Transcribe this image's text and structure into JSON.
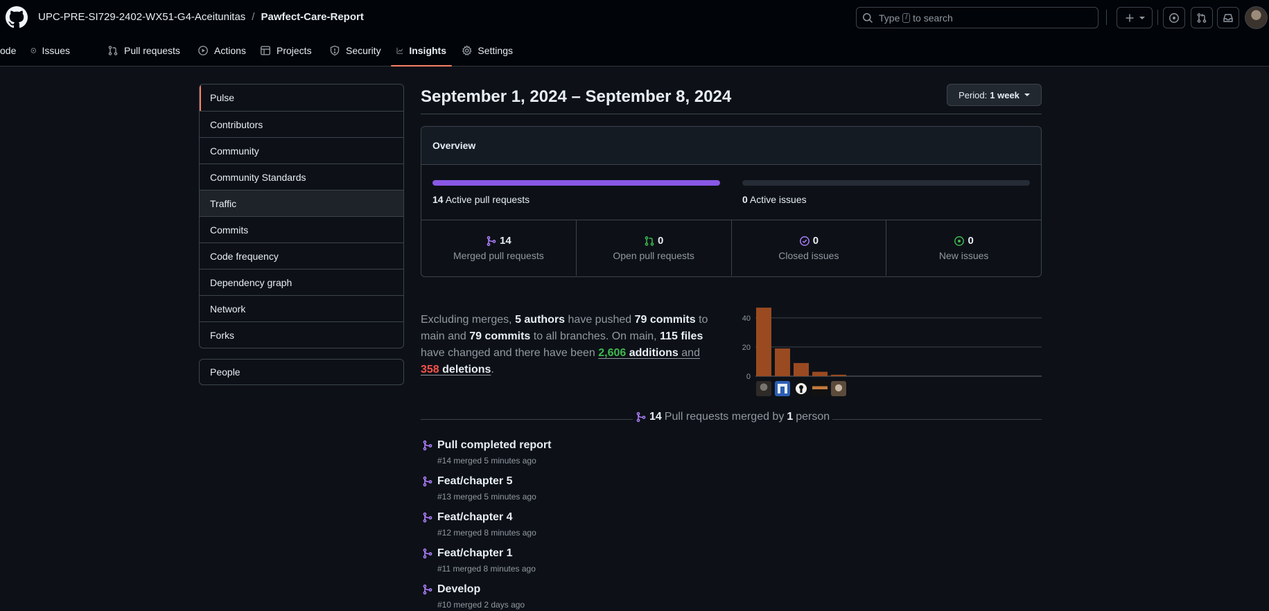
{
  "header": {
    "owner": "UPC-PRE-SI729-2402-WX51-G4-Aceitunitas",
    "separator": "/",
    "repo": "Pawfect-Care-Report",
    "search_prefix": "Type",
    "search_key": "/",
    "search_suffix": "to search"
  },
  "tabs": [
    {
      "label": "ode",
      "icon": "code-icon"
    },
    {
      "label": "Issues",
      "icon": "issue-opened-icon"
    },
    {
      "label": "Pull requests",
      "icon": "git-pull-request-icon"
    },
    {
      "label": "Actions",
      "icon": "play-icon"
    },
    {
      "label": "Projects",
      "icon": "table-icon"
    },
    {
      "label": "Security",
      "icon": "shield-icon"
    },
    {
      "label": "Insights",
      "icon": "graph-icon",
      "active": true
    },
    {
      "label": "Settings",
      "icon": "gear-icon"
    }
  ],
  "sidebar": {
    "items": [
      {
        "label": "Pulse",
        "selected": true
      },
      {
        "label": "Contributors"
      },
      {
        "label": "Community"
      },
      {
        "label": "Community Standards"
      },
      {
        "label": "Traffic",
        "hover": true
      },
      {
        "label": "Commits"
      },
      {
        "label": "Code frequency"
      },
      {
        "label": "Dependency graph"
      },
      {
        "label": "Network"
      },
      {
        "label": "Forks"
      }
    ],
    "people": "People"
  },
  "main": {
    "date_range": "September 1, 2024 – September 8, 2024",
    "period_prefix": "Period:",
    "period_value": "1 week"
  },
  "overview": {
    "title": "Overview",
    "active_prs_count": "14",
    "active_prs_label": "Active pull requests",
    "active_prs_fraction": 1.0,
    "active_issues_count": "0",
    "active_issues_label": "Active issues",
    "active_issues_fraction": 0.0,
    "stats": [
      {
        "value": "14",
        "label": "Merged pull requests",
        "icon": "git-merge-icon",
        "color": "#ab7df8"
      },
      {
        "value": "0",
        "label": "Open pull requests",
        "icon": "git-pull-request-icon",
        "color": "#3fb950"
      },
      {
        "value": "0",
        "label": "Closed issues",
        "icon": "issue-closed-icon",
        "color": "#ab7df8"
      },
      {
        "value": "0",
        "label": "New issues",
        "icon": "issue-opened-icon",
        "color": "#3fb950"
      }
    ]
  },
  "summary": {
    "t1": "Excluding merges, ",
    "authors": "5 authors",
    "t2": " have pushed ",
    "commits_main": "79 commits",
    "t3": " to main and ",
    "commits_all": "79 commits",
    "t4": " to all branches. On main, ",
    "files": "115 files",
    "t5": " have changed and there have been ",
    "additions_num": "2,606",
    "additions_word": " additions",
    "t6": " and",
    "deletions_num": "358",
    "deletions_word": " deletions",
    "t7": "."
  },
  "chart_data": {
    "type": "bar",
    "categories": [
      "author-1",
      "author-2",
      "author-3",
      "author-4",
      "author-5"
    ],
    "values": [
      47,
      19,
      9,
      3,
      1
    ],
    "yticks": [
      "0",
      "20",
      "40"
    ],
    "ylim": [
      0,
      48
    ],
    "bar_color": "#9a4a21"
  },
  "merged": {
    "count": "14",
    "text1": " Pull requests merged by ",
    "people": "1",
    "text2": " person",
    "items": [
      {
        "title": "Pull completed report",
        "meta": "#14 merged 5 minutes ago"
      },
      {
        "title": "Feat/chapter 5",
        "meta": "#13 merged 5 minutes ago"
      },
      {
        "title": "Feat/chapter 4",
        "meta": "#12 merged 8 minutes ago"
      },
      {
        "title": "Feat/chapter 1",
        "meta": "#11 merged 8 minutes ago"
      },
      {
        "title": "Develop",
        "meta": "#10 merged 2 days ago"
      }
    ]
  }
}
